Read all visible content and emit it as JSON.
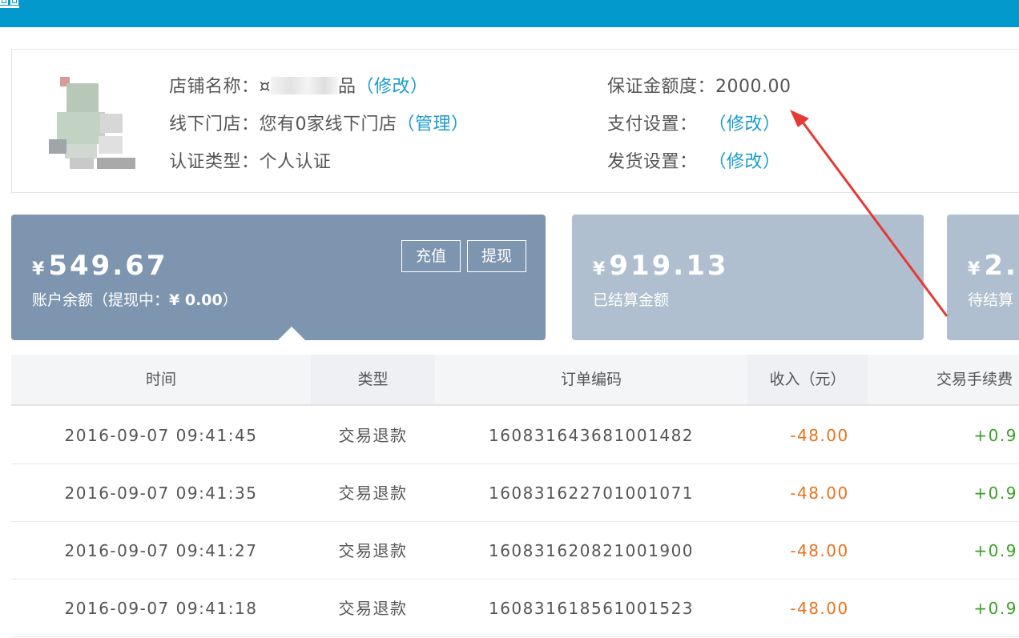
{
  "colors": {
    "topbar": "#0399cc",
    "link": "#1b9bce",
    "balance_card": "#7e95b0",
    "settled_card": "#b0bfcf",
    "negative": "#e8731d",
    "positive": "#39a124",
    "annotation_arrow": "#e53935"
  },
  "store": {
    "name_label": "店铺名称：",
    "name_value_start": "¤",
    "name_value_end": "品",
    "name_edit": "（修改）",
    "offline_label": "线下门店：",
    "offline_value": "您有0家线下门店",
    "offline_manage": "（管理）",
    "cert_label": "认证类型：",
    "cert_value": "个人认证",
    "deposit_label": "保证金额度：",
    "deposit_value": "2000.00",
    "payment_label": "支付设置：",
    "payment_edit": "（修改）",
    "shipping_label": "发货设置：",
    "shipping_edit": "（修改）"
  },
  "cards": {
    "balance": {
      "currency": "¥",
      "amount": "549.67",
      "label": "账户余额（提现中：",
      "pending": "¥ 0.00",
      "label_end": "）",
      "recharge": "充值",
      "withdraw": "提现"
    },
    "settled": {
      "currency": "¥",
      "amount": "919.13",
      "label": "已结算金额"
    },
    "unsettled": {
      "currency": "¥",
      "amount": "2.",
      "label": "待结算"
    }
  },
  "table": {
    "headers": [
      "时间",
      "类型",
      "订单编码",
      "收入（元）",
      "交易手续费"
    ],
    "rows": [
      [
        "2016-09-07 09:41:45",
        "交易退款",
        "160831643681001482",
        "-48.00",
        "+0.9"
      ],
      [
        "2016-09-07 09:41:35",
        "交易退款",
        "160831622701001071",
        "-48.00",
        "+0.9"
      ],
      [
        "2016-09-07 09:41:27",
        "交易退款",
        "160831620821001900",
        "-48.00",
        "+0.9"
      ],
      [
        "2016-09-07 09:41:18",
        "交易退款",
        "160831618561001523",
        "-48.00",
        "+0.9"
      ]
    ]
  }
}
